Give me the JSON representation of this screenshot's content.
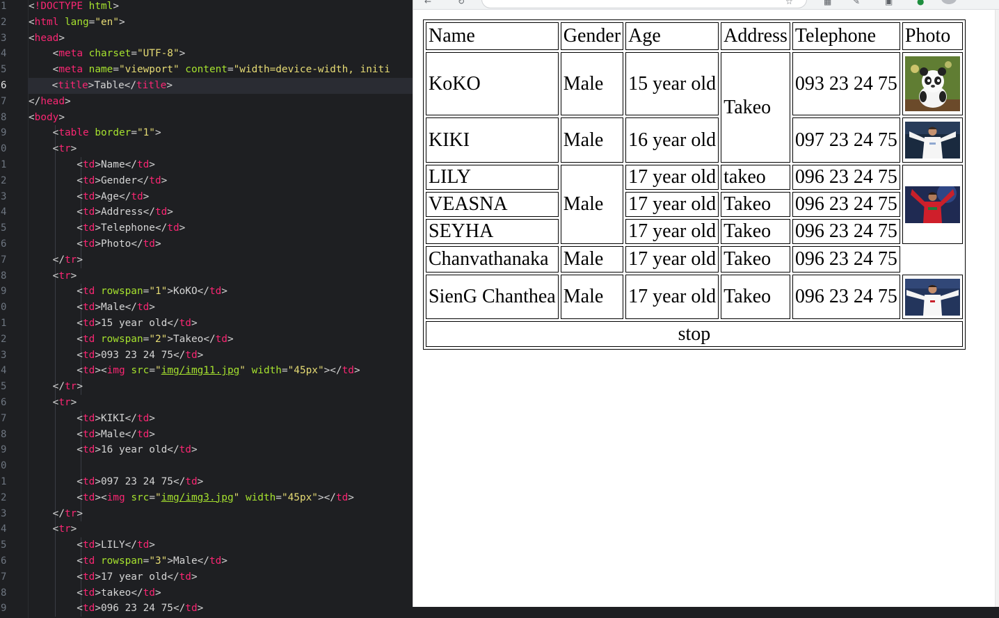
{
  "editor": {
    "active_line": "6",
    "line_numbers": [
      "1",
      "2",
      "3",
      "4",
      "5",
      "6",
      "7",
      "8",
      "9",
      "0",
      "1",
      "2",
      "3",
      "4",
      "5",
      "6",
      "7",
      "8",
      "9",
      "0",
      "1",
      "2",
      "3",
      "4",
      "5",
      "6",
      "7",
      "8",
      "9",
      "0",
      "1",
      "2",
      "3",
      "4",
      "5",
      "6",
      "7",
      "8",
      "9"
    ],
    "lines": [
      [
        [
          "p",
          "<"
        ],
        [
          "t",
          "!DOCTYPE"
        ],
        [
          "p",
          " "
        ],
        [
          "a",
          "html"
        ],
        [
          "p",
          ">"
        ]
      ],
      [
        [
          "p",
          "<"
        ],
        [
          "t",
          "html"
        ],
        [
          "p",
          " "
        ],
        [
          "a",
          "lang"
        ],
        [
          "p",
          "="
        ],
        [
          "s",
          "\"en\""
        ],
        [
          "p",
          ">"
        ]
      ],
      [
        [
          "p",
          "<"
        ],
        [
          "t",
          "head"
        ],
        [
          "p",
          ">"
        ]
      ],
      [
        [
          "p",
          "    <"
        ],
        [
          "t",
          "meta"
        ],
        [
          "p",
          " "
        ],
        [
          "a",
          "charset"
        ],
        [
          "p",
          "="
        ],
        [
          "s",
          "\"UTF-8\""
        ],
        [
          "p",
          ">"
        ]
      ],
      [
        [
          "p",
          "    <"
        ],
        [
          "t",
          "meta"
        ],
        [
          "p",
          " "
        ],
        [
          "a",
          "name"
        ],
        [
          "p",
          "="
        ],
        [
          "s",
          "\"viewport\""
        ],
        [
          "p",
          " "
        ],
        [
          "a",
          "content"
        ],
        [
          "p",
          "="
        ],
        [
          "s",
          "\"width=device-width, initi"
        ]
      ],
      [
        [
          "p",
          "    <"
        ],
        [
          "t",
          "title"
        ],
        [
          "p",
          ">"
        ],
        [
          "x",
          "Table"
        ],
        [
          "p",
          "</"
        ],
        [
          "t",
          "title"
        ],
        [
          "p",
          ">"
        ]
      ],
      [
        [
          "p",
          "</"
        ],
        [
          "t",
          "head"
        ],
        [
          "p",
          ">"
        ]
      ],
      [
        [
          "p",
          "<"
        ],
        [
          "t",
          "body"
        ],
        [
          "p",
          ">"
        ]
      ],
      [
        [
          "p",
          "    <"
        ],
        [
          "t",
          "table"
        ],
        [
          "p",
          " "
        ],
        [
          "a",
          "border"
        ],
        [
          "p",
          "="
        ],
        [
          "s",
          "\"1\""
        ],
        [
          "p",
          ">"
        ]
      ],
      [
        [
          "p",
          "    <"
        ],
        [
          "t",
          "tr"
        ],
        [
          "p",
          ">"
        ]
      ],
      [
        [
          "p",
          "        <"
        ],
        [
          "t",
          "td"
        ],
        [
          "p",
          ">"
        ],
        [
          "x",
          "Name"
        ],
        [
          "p",
          "</"
        ],
        [
          "t",
          "td"
        ],
        [
          "p",
          ">"
        ]
      ],
      [
        [
          "p",
          "        <"
        ],
        [
          "t",
          "td"
        ],
        [
          "p",
          ">"
        ],
        [
          "x",
          "Gender"
        ],
        [
          "p",
          "</"
        ],
        [
          "t",
          "td"
        ],
        [
          "p",
          ">"
        ]
      ],
      [
        [
          "p",
          "        <"
        ],
        [
          "t",
          "td"
        ],
        [
          "p",
          ">"
        ],
        [
          "x",
          "Age"
        ],
        [
          "p",
          "</"
        ],
        [
          "t",
          "td"
        ],
        [
          "p",
          ">"
        ]
      ],
      [
        [
          "p",
          "        <"
        ],
        [
          "t",
          "td"
        ],
        [
          "p",
          ">"
        ],
        [
          "x",
          "Address"
        ],
        [
          "p",
          "</"
        ],
        [
          "t",
          "td"
        ],
        [
          "p",
          ">"
        ]
      ],
      [
        [
          "p",
          "        <"
        ],
        [
          "t",
          "td"
        ],
        [
          "p",
          ">"
        ],
        [
          "x",
          "Telephone"
        ],
        [
          "p",
          "</"
        ],
        [
          "t",
          "td"
        ],
        [
          "p",
          ">"
        ]
      ],
      [
        [
          "p",
          "        <"
        ],
        [
          "t",
          "td"
        ],
        [
          "p",
          ">"
        ],
        [
          "x",
          "Photo"
        ],
        [
          "p",
          "</"
        ],
        [
          "t",
          "td"
        ],
        [
          "p",
          ">"
        ]
      ],
      [
        [
          "p",
          "    </"
        ],
        [
          "t",
          "tr"
        ],
        [
          "p",
          ">"
        ]
      ],
      [
        [
          "p",
          "    <"
        ],
        [
          "t",
          "tr"
        ],
        [
          "p",
          ">"
        ]
      ],
      [
        [
          "p",
          "        <"
        ],
        [
          "t",
          "td"
        ],
        [
          "p",
          " "
        ],
        [
          "a",
          "rowspan"
        ],
        [
          "p",
          "="
        ],
        [
          "s",
          "\"1\""
        ],
        [
          "p",
          ">"
        ],
        [
          "x",
          "KoKO"
        ],
        [
          "p",
          "</"
        ],
        [
          "t",
          "td"
        ],
        [
          "p",
          ">"
        ]
      ],
      [
        [
          "p",
          "        <"
        ],
        [
          "t",
          "td"
        ],
        [
          "p",
          ">"
        ],
        [
          "x",
          "Male"
        ],
        [
          "p",
          "</"
        ],
        [
          "t",
          "td"
        ],
        [
          "p",
          ">"
        ]
      ],
      [
        [
          "p",
          "        <"
        ],
        [
          "t",
          "td"
        ],
        [
          "p",
          ">"
        ],
        [
          "x",
          "15 year old"
        ],
        [
          "p",
          "</"
        ],
        [
          "t",
          "td"
        ],
        [
          "p",
          ">"
        ]
      ],
      [
        [
          "p",
          "        <"
        ],
        [
          "t",
          "td"
        ],
        [
          "p",
          " "
        ],
        [
          "a",
          "rowspan"
        ],
        [
          "p",
          "="
        ],
        [
          "s",
          "\"2\""
        ],
        [
          "p",
          ">"
        ],
        [
          "x",
          "Takeo"
        ],
        [
          "p",
          "</"
        ],
        [
          "t",
          "td"
        ],
        [
          "p",
          ">"
        ]
      ],
      [
        [
          "p",
          "        <"
        ],
        [
          "t",
          "td"
        ],
        [
          "p",
          ">"
        ],
        [
          "x",
          "093 23 24 75"
        ],
        [
          "p",
          "</"
        ],
        [
          "t",
          "td"
        ],
        [
          "p",
          ">"
        ]
      ],
      [
        [
          "p",
          "        <"
        ],
        [
          "t",
          "td"
        ],
        [
          "p",
          "><"
        ],
        [
          "t",
          "img"
        ],
        [
          "p",
          " "
        ],
        [
          "a",
          "src"
        ],
        [
          "p",
          "="
        ],
        [
          "s",
          "\""
        ],
        [
          "u",
          "img/img11.jpg"
        ],
        [
          "s",
          "\""
        ],
        [
          "p",
          " "
        ],
        [
          "a",
          "width"
        ],
        [
          "p",
          "="
        ],
        [
          "s",
          "\"45px\""
        ],
        [
          "p",
          "></"
        ],
        [
          "t",
          "td"
        ],
        [
          "p",
          ">"
        ]
      ],
      [
        [
          "p",
          "    </"
        ],
        [
          "t",
          "tr"
        ],
        [
          "p",
          ">"
        ]
      ],
      [
        [
          "p",
          "    <"
        ],
        [
          "t",
          "tr"
        ],
        [
          "p",
          ">"
        ]
      ],
      [
        [
          "p",
          "        <"
        ],
        [
          "t",
          "td"
        ],
        [
          "p",
          ">"
        ],
        [
          "x",
          "KIKI"
        ],
        [
          "p",
          "</"
        ],
        [
          "t",
          "td"
        ],
        [
          "p",
          ">"
        ]
      ],
      [
        [
          "p",
          "        <"
        ],
        [
          "t",
          "td"
        ],
        [
          "p",
          ">"
        ],
        [
          "x",
          "Male"
        ],
        [
          "p",
          "</"
        ],
        [
          "t",
          "td"
        ],
        [
          "p",
          ">"
        ]
      ],
      [
        [
          "p",
          "        <"
        ],
        [
          "t",
          "td"
        ],
        [
          "p",
          ">"
        ],
        [
          "x",
          "16 year old"
        ],
        [
          "p",
          "</"
        ],
        [
          "t",
          "td"
        ],
        [
          "p",
          ">"
        ]
      ],
      [],
      [
        [
          "p",
          "        <"
        ],
        [
          "t",
          "td"
        ],
        [
          "p",
          ">"
        ],
        [
          "x",
          "097 23 24 75"
        ],
        [
          "p",
          "</"
        ],
        [
          "t",
          "td"
        ],
        [
          "p",
          ">"
        ]
      ],
      [
        [
          "p",
          "        <"
        ],
        [
          "t",
          "td"
        ],
        [
          "p",
          "><"
        ],
        [
          "t",
          "img"
        ],
        [
          "p",
          " "
        ],
        [
          "a",
          "src"
        ],
        [
          "p",
          "="
        ],
        [
          "s",
          "\""
        ],
        [
          "u",
          "img/img3.jpg"
        ],
        [
          "s",
          "\""
        ],
        [
          "p",
          " "
        ],
        [
          "a",
          "width"
        ],
        [
          "p",
          "="
        ],
        [
          "s",
          "\"45px\""
        ],
        [
          "p",
          "></"
        ],
        [
          "t",
          "td"
        ],
        [
          "p",
          ">"
        ]
      ],
      [
        [
          "p",
          "    </"
        ],
        [
          "t",
          "tr"
        ],
        [
          "p",
          ">"
        ]
      ],
      [
        [
          "p",
          "    <"
        ],
        [
          "t",
          "tr"
        ],
        [
          "p",
          ">"
        ]
      ],
      [
        [
          "p",
          "        <"
        ],
        [
          "t",
          "td"
        ],
        [
          "p",
          ">"
        ],
        [
          "x",
          "LILY"
        ],
        [
          "p",
          "</"
        ],
        [
          "t",
          "td"
        ],
        [
          "p",
          ">"
        ]
      ],
      [
        [
          "p",
          "        <"
        ],
        [
          "t",
          "td"
        ],
        [
          "p",
          " "
        ],
        [
          "a",
          "rowspan"
        ],
        [
          "p",
          "="
        ],
        [
          "s",
          "\"3\""
        ],
        [
          "p",
          ">"
        ],
        [
          "x",
          "Male"
        ],
        [
          "p",
          "</"
        ],
        [
          "t",
          "td"
        ],
        [
          "p",
          ">"
        ]
      ],
      [
        [
          "p",
          "        <"
        ],
        [
          "t",
          "td"
        ],
        [
          "p",
          ">"
        ],
        [
          "x",
          "17 year old"
        ],
        [
          "p",
          "</"
        ],
        [
          "t",
          "td"
        ],
        [
          "p",
          ">"
        ]
      ],
      [
        [
          "p",
          "        <"
        ],
        [
          "t",
          "td"
        ],
        [
          "p",
          ">"
        ],
        [
          "x",
          "takeo"
        ],
        [
          "p",
          "</"
        ],
        [
          "t",
          "td"
        ],
        [
          "p",
          ">"
        ]
      ],
      [
        [
          "p",
          "        <"
        ],
        [
          "t",
          "td"
        ],
        [
          "p",
          ">"
        ],
        [
          "x",
          "096 23 24 75"
        ],
        [
          "p",
          "</"
        ],
        [
          "t",
          "td"
        ],
        [
          "p",
          ">"
        ]
      ]
    ]
  },
  "table": {
    "headers": [
      "Name",
      "Gender",
      "Age",
      "Address",
      "Telephone",
      "Photo"
    ],
    "rows": [
      {
        "name": "KoKO",
        "gender": "Male",
        "age": "15 year old",
        "address": "Takeo",
        "phone": "093 23 24 75",
        "photo": "panda-photo"
      },
      {
        "name": "KIKI",
        "gender": "Male",
        "age": "16 year old",
        "phone": "097 23 24 75",
        "photo": "player-photo-white-kit"
      },
      {
        "name": "LILY",
        "gender": "Male",
        "age": "17 year old",
        "address": "takeo",
        "phone": "096 23 24 75",
        "photo": "player-photo-red-kit"
      },
      {
        "name": "VEASNA",
        "age": "17 year old",
        "address": "Takeo",
        "phone": "096 23 24 75"
      },
      {
        "name": "SEYHA",
        "age": "17 year old",
        "address": "Takeo",
        "phone": "096 23 24 75"
      },
      {
        "name": "Chanvathanaka",
        "gender": "Male",
        "age": "17 year old",
        "address": "Takeo",
        "phone": "096 23 24 75"
      },
      {
        "name": "SienG Chanthea",
        "gender": "Male",
        "age": "17 year old",
        "address": "Takeo",
        "phone": "096 23 24 75",
        "photo": "player-photo-white-kit-2"
      }
    ],
    "footer": "stop"
  },
  "colors": {
    "editor_bg": "#1e1f22",
    "tag": "#f92672",
    "attribute": "#a6e22e",
    "string": "#e6db74",
    "punctuation": "#d4d4d4"
  },
  "browser": {
    "toolbar_icons": [
      "reload-icon",
      "bookmark-star-icon",
      "extensions-icon",
      "profile-avatar-icon"
    ]
  }
}
